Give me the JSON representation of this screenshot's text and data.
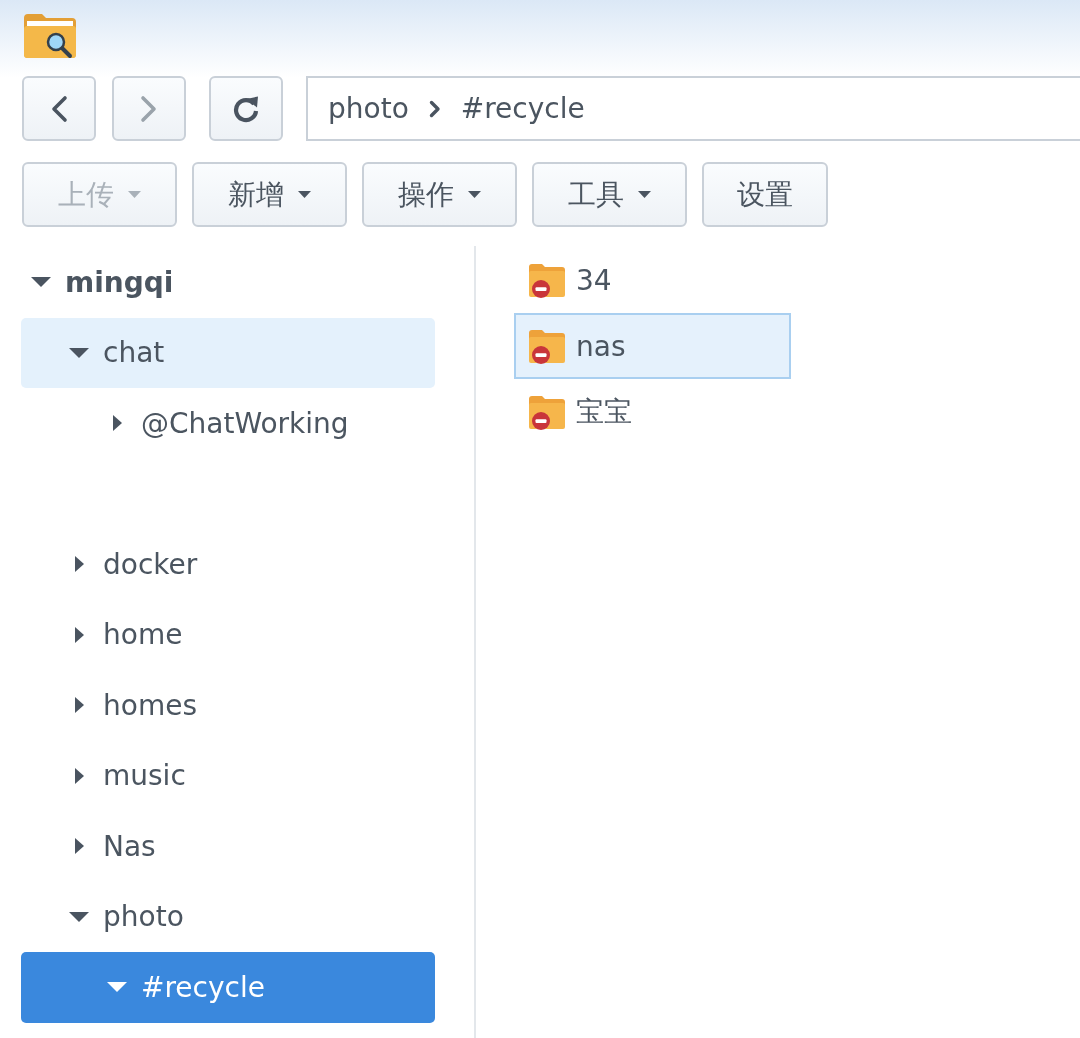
{
  "nav_buttons": [
    {
      "kind": "back",
      "disabled": false
    },
    {
      "kind": "forward",
      "disabled": true
    },
    {
      "kind": "refresh",
      "disabled": false
    }
  ],
  "path": {
    "segments": [
      "photo",
      "#recycle"
    ]
  },
  "toolbar": [
    {
      "label": "上传",
      "dropdown": true,
      "disabled": true
    },
    {
      "label": "新增",
      "dropdown": true,
      "disabled": false
    },
    {
      "label": "操作",
      "dropdown": true,
      "disabled": false
    },
    {
      "label": "工具",
      "dropdown": true,
      "disabled": false
    },
    {
      "label": "设置",
      "dropdown": false,
      "disabled": false
    }
  ],
  "tree": [
    {
      "label": "mingqi",
      "expanded": true,
      "selected": false,
      "highlighted": false,
      "children": [
        {
          "label": "chat",
          "expanded": true,
          "selected": false,
          "highlighted": true,
          "children": [
            {
              "label": "@ChatWorking",
              "expanded": false,
              "selected": false,
              "highlighted": false
            }
          ]
        },
        {
          "label": "docker",
          "expanded": false,
          "selected": false,
          "highlighted": false
        },
        {
          "label": "home",
          "expanded": false,
          "selected": false,
          "highlighted": false
        },
        {
          "label": "homes",
          "expanded": false,
          "selected": false,
          "highlighted": false
        },
        {
          "label": "music",
          "expanded": false,
          "selected": false,
          "highlighted": false
        },
        {
          "label": "Nas",
          "expanded": false,
          "selected": false,
          "highlighted": false
        },
        {
          "label": "photo",
          "expanded": true,
          "selected": false,
          "highlighted": false,
          "children": [
            {
              "label": "#recycle",
              "expanded": true,
              "selected": true,
              "highlighted": false
            }
          ]
        }
      ]
    }
  ],
  "files": [
    {
      "name": "34",
      "selected": false
    },
    {
      "name": "nas",
      "selected": true
    },
    {
      "name": "宝宝",
      "selected": false
    }
  ]
}
